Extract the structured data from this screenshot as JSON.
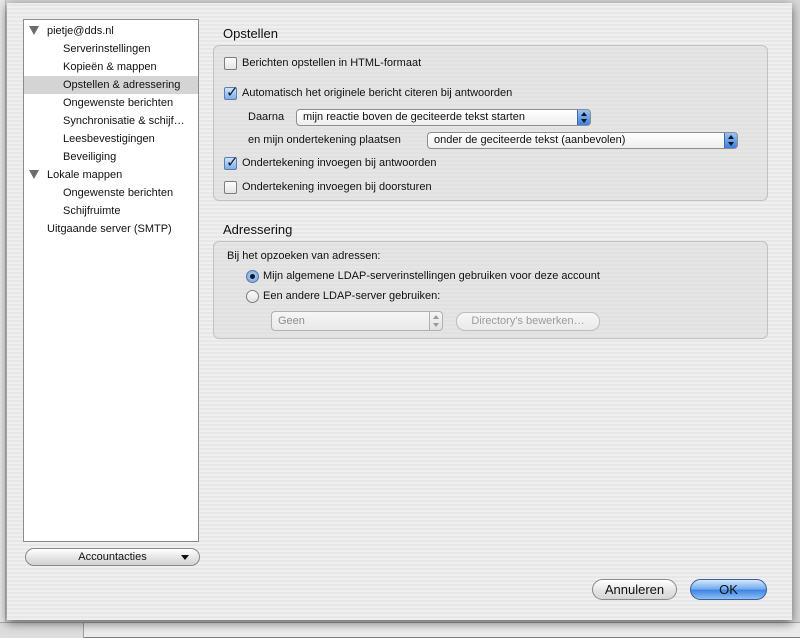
{
  "tree": {
    "items": [
      {
        "label": "pietje@dds.nl",
        "expander": true,
        "level": 0,
        "selected": false
      },
      {
        "label": "Serverinstellingen",
        "expander": false,
        "level": 1,
        "selected": false
      },
      {
        "label": "Kopieën & mappen",
        "expander": false,
        "level": 1,
        "selected": false
      },
      {
        "label": "Opstellen & adressering",
        "expander": false,
        "level": 1,
        "selected": true
      },
      {
        "label": "Ongewenste berichten",
        "expander": false,
        "level": 1,
        "selected": false
      },
      {
        "label": "Synchronisatie & schijf…",
        "expander": false,
        "level": 1,
        "selected": false
      },
      {
        "label": "Leesbevestigingen",
        "expander": false,
        "level": 1,
        "selected": false
      },
      {
        "label": "Beveiliging",
        "expander": false,
        "level": 1,
        "selected": false
      },
      {
        "label": "Lokale mappen",
        "expander": true,
        "level": 0,
        "selected": false
      },
      {
        "label": "Ongewenste berichten",
        "expander": false,
        "level": 1,
        "selected": false
      },
      {
        "label": "Schijfruimte",
        "expander": false,
        "level": 1,
        "selected": false
      },
      {
        "label": "Uitgaande server (SMTP)",
        "expander": false,
        "level": 0,
        "selected": false
      }
    ],
    "account_actions": "Accountacties"
  },
  "compose": {
    "title": "Opstellen",
    "html_format": {
      "label": "Berichten opstellen in HTML-formaat",
      "checked": false
    },
    "auto_quote": {
      "label": "Automatisch het originele bericht citeren bij antwoorden",
      "checked": true
    },
    "then_label": "Daarna",
    "then_value": "mijn reactie boven de geciteerde tekst starten",
    "signature_place_label": "en mijn ondertekening plaatsen",
    "signature_place_value": "onder de geciteerde tekst (aanbevolen)",
    "sig_reply": {
      "label": "Ondertekening invoegen bij antwoorden",
      "checked": true
    },
    "sig_forward": {
      "label": "Ondertekening invoegen bij doorsturen",
      "checked": false
    }
  },
  "addressing": {
    "title": "Adressering",
    "lookup_label": "Bij het opzoeken van adressen:",
    "radio_global": {
      "label": "Mijn algemene LDAP-serverinstellingen gebruiken voor deze account",
      "selected": true
    },
    "radio_other": {
      "label": "Een andere LDAP-server gebruiken:",
      "selected": false
    },
    "ldap_select": "Geen",
    "edit_directories": "Directory's bewerken…"
  },
  "footer": {
    "cancel": "Annuleren",
    "ok": "OK"
  },
  "colors": {
    "accent": "#3a82e3",
    "selected_row": "#d4d4d4"
  }
}
